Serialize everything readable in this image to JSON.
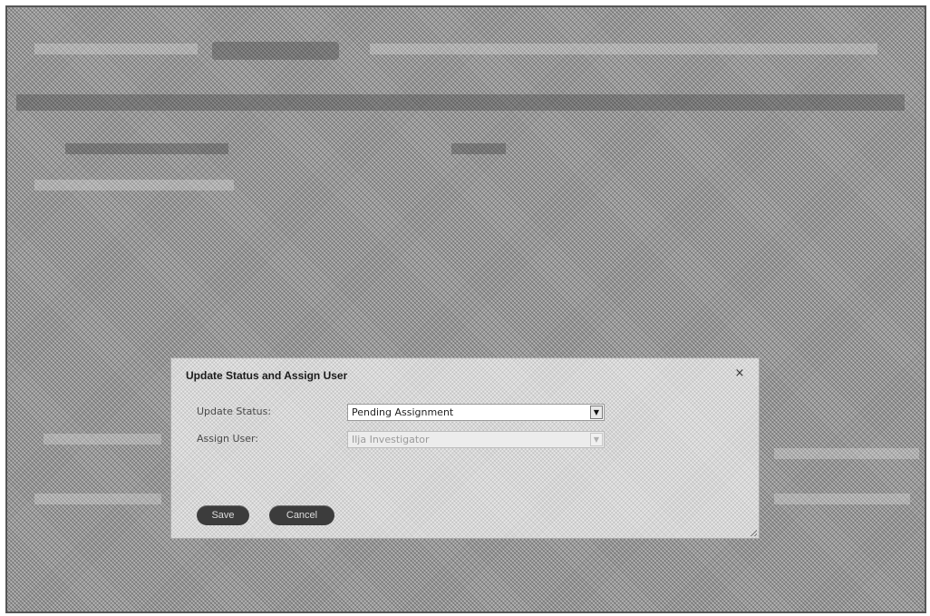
{
  "dialog": {
    "title": "Update Status and Assign User",
    "close_icon": "close-icon",
    "fields": [
      {
        "label": "Update Status:",
        "value": "Pending Assignment",
        "disabled": false
      },
      {
        "label": "Assign User:",
        "value": "Ilja Investigator",
        "disabled": true
      }
    ],
    "buttons": {
      "save_label": "Save",
      "cancel_label": "Cancel"
    }
  },
  "glyphs": {
    "close": "×",
    "dropdown": "▼"
  }
}
